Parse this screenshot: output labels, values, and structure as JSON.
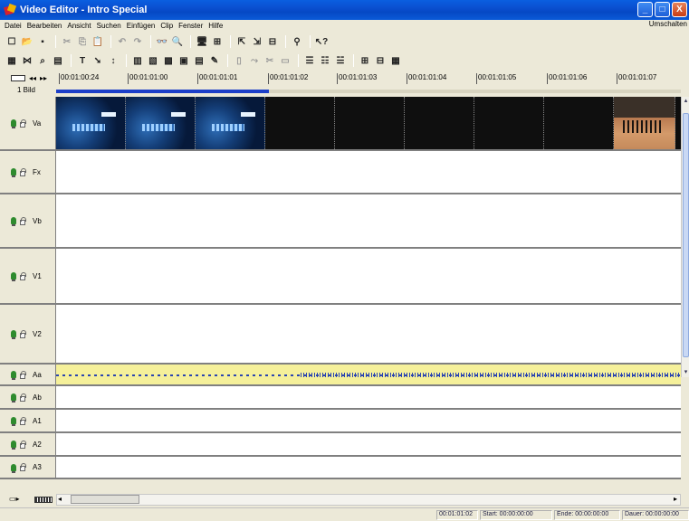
{
  "window": {
    "title": "Video Editor - Intro Special",
    "minimize": "_",
    "maximize": "□",
    "close": "X"
  },
  "menu": {
    "items": [
      "Datei",
      "Bearbeiten",
      "Ansicht",
      "Suchen",
      "Einfügen",
      "Clip",
      "Fenster",
      "Hilfe"
    ],
    "right": "Umschalten"
  },
  "toolbar1": [
    {
      "icon": "new-icon",
      "glyph": "☐"
    },
    {
      "icon": "open-icon",
      "glyph": "📂"
    },
    {
      "icon": "save-icon",
      "glyph": "▪"
    },
    {
      "icon": "cut-icon",
      "glyph": "✂",
      "dim": true
    },
    {
      "icon": "copy-icon",
      "glyph": "⎘",
      "dim": true
    },
    {
      "icon": "paste-icon",
      "glyph": "📋",
      "dim": true
    },
    {
      "icon": "undo-icon",
      "glyph": "↶",
      "dim": true
    },
    {
      "icon": "redo-icon",
      "glyph": "↷",
      "dim": true
    },
    {
      "icon": "find-icon",
      "glyph": "👓"
    },
    {
      "icon": "find-next-icon",
      "glyph": "🔍"
    },
    {
      "icon": "monitor-icon",
      "glyph": "🖥"
    },
    {
      "icon": "split-icon",
      "glyph": "⊞"
    },
    {
      "icon": "export-icon",
      "glyph": "⇱"
    },
    {
      "icon": "import-icon",
      "glyph": "⇲"
    },
    {
      "icon": "lock-icon",
      "glyph": "⊟"
    },
    {
      "icon": "binoculars-icon",
      "glyph": "⚲"
    },
    {
      "icon": "help-icon",
      "glyph": "↖?"
    }
  ],
  "toolbar2": [
    {
      "icon": "grid-icon",
      "glyph": "▦"
    },
    {
      "icon": "trim-icon",
      "glyph": "⋈"
    },
    {
      "icon": "zoom-icon",
      "glyph": "⌕"
    },
    {
      "icon": "page-icon",
      "glyph": "▤"
    },
    {
      "icon": "text-icon",
      "glyph": "T"
    },
    {
      "icon": "arrow-icon",
      "glyph": "➘"
    },
    {
      "icon": "marker-icon",
      "glyph": "↕"
    },
    {
      "icon": "timeline-icon",
      "glyph": "▥"
    },
    {
      "icon": "transition-icon",
      "glyph": "▧"
    },
    {
      "icon": "storyboard-icon",
      "glyph": "▩"
    },
    {
      "icon": "clip-icon",
      "glyph": "▣"
    },
    {
      "icon": "render-icon",
      "glyph": "▤"
    },
    {
      "icon": "effect-icon",
      "glyph": "✎"
    },
    {
      "icon": "dim-tool-1-icon",
      "glyph": "▯",
      "dim": true
    },
    {
      "icon": "dim-tool-2-icon",
      "glyph": "⤳",
      "dim": true
    },
    {
      "icon": "dim-tool-3-icon",
      "glyph": "✂",
      "dim": true
    },
    {
      "icon": "dim-tool-4-icon",
      "glyph": "▭",
      "dim": true
    },
    {
      "icon": "align-left-icon",
      "glyph": "☰"
    },
    {
      "icon": "align-center-icon",
      "glyph": "☷"
    },
    {
      "icon": "align-right-icon",
      "glyph": "☱"
    },
    {
      "icon": "group-icon",
      "glyph": "⊞"
    },
    {
      "icon": "ungroup-icon",
      "glyph": "⊟"
    },
    {
      "icon": "film-icon",
      "glyph": "▦"
    }
  ],
  "ruler": {
    "scale_label": "1 Bild",
    "timecodes": [
      "00:01:00:24",
      "00:01:01:00",
      "00:01:01:01",
      "00:01:01:02",
      "00:01:01:03",
      "00:01:01:04",
      "00:01:01:05",
      "00:01:01:06",
      "00:01:01:07"
    ],
    "rendered_fraction": 0.34
  },
  "tracks": [
    {
      "id": "va",
      "name": "Va",
      "kind": "video"
    },
    {
      "id": "fx",
      "name": "Fx",
      "kind": "empty"
    },
    {
      "id": "vb",
      "name": "Vb",
      "kind": "empty"
    },
    {
      "id": "v1",
      "name": "V1",
      "kind": "empty"
    },
    {
      "id": "v2",
      "name": "V2",
      "kind": "empty"
    },
    {
      "id": "aa",
      "name": "Aa",
      "kind": "audio"
    },
    {
      "id": "ab",
      "name": "Ab",
      "kind": "empty"
    },
    {
      "id": "a1",
      "name": "A1",
      "kind": "empty"
    },
    {
      "id": "a2",
      "name": "A2",
      "kind": "empty"
    },
    {
      "id": "a3",
      "name": "A3",
      "kind": "empty"
    }
  ],
  "colors": {
    "titlebar": "#0a5ad8",
    "audio_track": "#f5f09a",
    "progress": "#1c3fc8"
  },
  "status": {
    "position": "00:01:01:02",
    "start": "Start: 00:00:00:00",
    "end": "Ende: 00:00:00:00",
    "duration": "Dauer: 00:00:00:00"
  }
}
